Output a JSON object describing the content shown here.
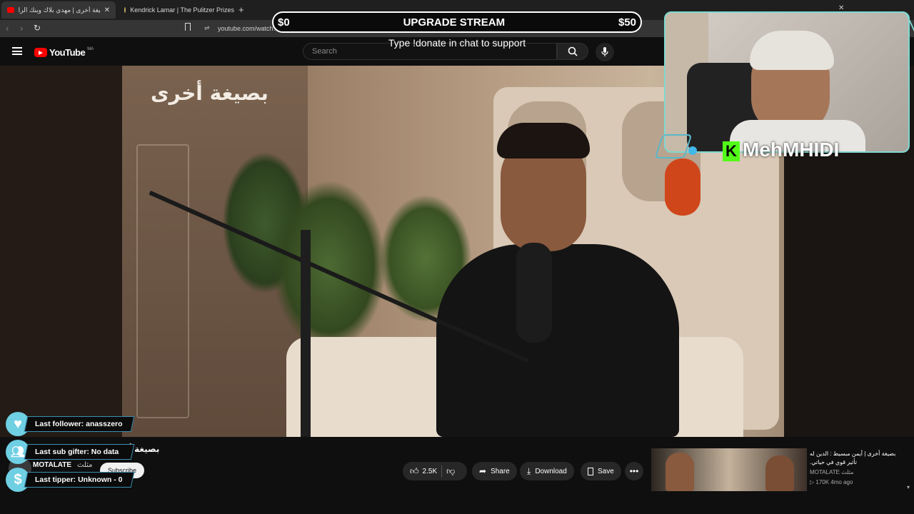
{
  "browser": {
    "tabs": [
      {
        "label": "بصيغة أخرى | مهدي بلاك وينك الرا"
      },
      {
        "label": "Kendrick Lamar | The Pulitzer Prizes"
      }
    ],
    "new_tab_label": "+",
    "url": "youtube.com/watch?v=8ybW-pgkYPA"
  },
  "youtube": {
    "logo_text": "YouTube",
    "region": "MA",
    "search_placeholder": "Search"
  },
  "overlay": {
    "donate_left": "$0",
    "donate_title": "UPGRADE STREAM",
    "donate_right": "$50",
    "donate_hint": "Type !donate in chat to support",
    "streamer_name": "MehMHIDI",
    "alerts": [
      {
        "label": "Last follower: anasszero"
      },
      {
        "label": "Last sub gifter: No data"
      },
      {
        "label": "Last tipper: Unknown - 0"
      }
    ]
  },
  "video": {
    "title_partial": "بصيغة أخ",
    "watermark": "بصيغة أخرى",
    "channel": "MOTALATE",
    "channel_suffix": "مثلث",
    "subscribe": "Subscribe",
    "likes": "2.5K",
    "share": "Share",
    "download": "Download",
    "save": "Save"
  },
  "recommended": {
    "title_line1": "بصيغة أخرى | أيمن مبسيط : الدين له",
    "title_line2": "تأثير قوي في حياتي.",
    "channel": "MOTALATE مثلث",
    "meta": "▷ 170K  4mo ago"
  },
  "colors": {
    "accent": "#7fd8d0",
    "kick_green": "#53fc18",
    "youtube_red": "#ff0000"
  }
}
